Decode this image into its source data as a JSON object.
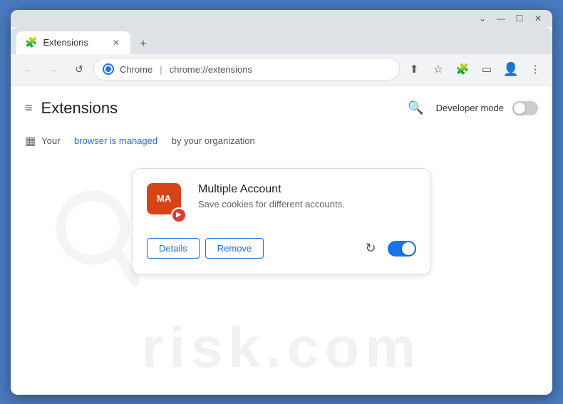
{
  "window": {
    "title": "Extensions",
    "tab_title": "Extensions",
    "favicon": "🧩"
  },
  "titlebar": {
    "controls": {
      "chevron_down": "⌄",
      "minimize": "—",
      "maximize": "☐",
      "close": "✕"
    }
  },
  "toolbar": {
    "back_label": "←",
    "forward_label": "→",
    "reload_label": "↺",
    "address_site": "Chrome",
    "address_separator": "|",
    "address_url": "chrome://extensions",
    "share_icon": "⬆",
    "star_icon": "☆",
    "extensions_icon": "🧩",
    "sidebar_icon": "▭",
    "profile_icon": "👤",
    "menu_icon": "⋮"
  },
  "page": {
    "hamburger": "≡",
    "title": "Extensions",
    "search_icon": "🔍",
    "developer_mode_label": "Developer mode"
  },
  "managed_banner": {
    "icon": "▦",
    "text_before": "Your",
    "link_text": "browser is managed",
    "text_after": "by your organization"
  },
  "extension_card": {
    "name": "Multiple Account",
    "description": "Save cookies for different accounts.",
    "details_btn": "Details",
    "remove_btn": "Remove",
    "enabled": true
  },
  "watermark": {
    "text": "risk.com"
  }
}
